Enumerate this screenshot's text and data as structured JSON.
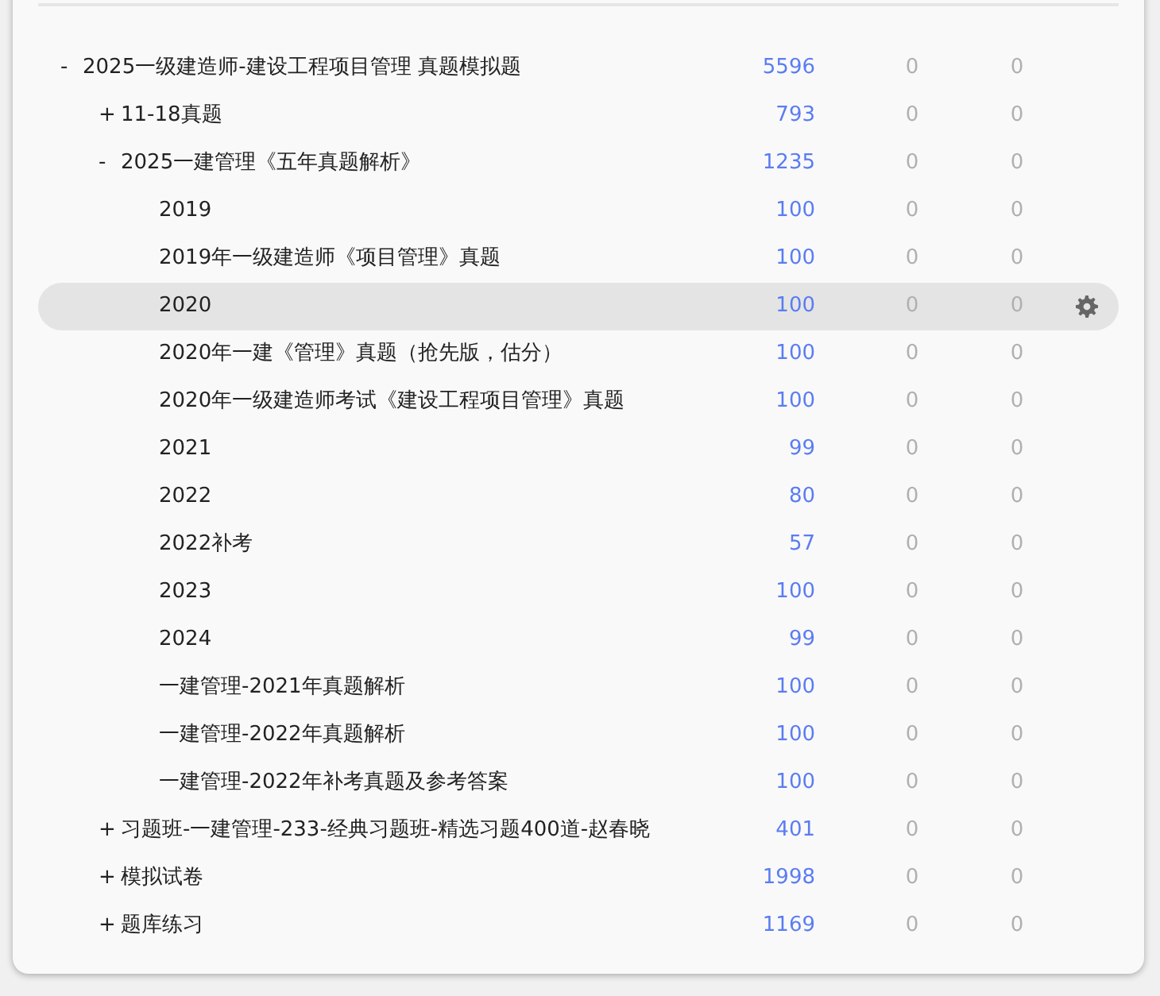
{
  "tree": [
    {
      "toggle": "-",
      "label": "2025一级建造师-建设工程项目管理 真题模拟题",
      "count": "5596",
      "column_3": "0",
      "column_4": "0",
      "selected": false,
      "children": [
        {
          "toggle": "+",
          "label": "11-18真题",
          "count": "793",
          "column_3": "0",
          "column_4": "0",
          "selected": false
        },
        {
          "toggle": "-",
          "label": "2025一建管理《五年真题解析》",
          "count": "1235",
          "column_3": "0",
          "column_4": "0",
          "selected": false,
          "children": [
            {
              "label": "2019",
              "count": "100",
              "column_3": "0",
              "column_4": "0",
              "selected": false
            },
            {
              "label": "2019年一级建造师《项目管理》真题",
              "count": "100",
              "column_3": "0",
              "column_4": "0",
              "selected": false
            },
            {
              "label": "2020",
              "count": "100",
              "column_3": "0",
              "column_4": "0",
              "selected": true
            },
            {
              "label": "2020年一建《管理》真题（抢先版，估分）",
              "count": "100",
              "column_3": "0",
              "column_4": "0",
              "selected": false
            },
            {
              "label": "2020年一级建造师考试《建设工程项目管理》真题",
              "count": "100",
              "column_3": "0",
              "column_4": "0",
              "selected": false
            },
            {
              "label": "2021",
              "count": "99",
              "column_3": "0",
              "column_4": "0",
              "selected": false
            },
            {
              "label": "2022",
              "count": "80",
              "column_3": "0",
              "column_4": "0",
              "selected": false
            },
            {
              "label": "2022补考",
              "count": "57",
              "column_3": "0",
              "column_4": "0",
              "selected": false
            },
            {
              "label": "2023",
              "count": "100",
              "column_3": "0",
              "column_4": "0",
              "selected": false
            },
            {
              "label": "2024",
              "count": "99",
              "column_3": "0",
              "column_4": "0",
              "selected": false
            },
            {
              "label": "一建管理-2021年真题解析",
              "count": "100",
              "column_3": "0",
              "column_4": "0",
              "selected": false
            },
            {
              "label": "一建管理-2022年真题解析",
              "count": "100",
              "column_3": "0",
              "column_4": "0",
              "selected": false
            },
            {
              "label": "一建管理-2022年补考真题及参考答案",
              "count": "100",
              "column_3": "0",
              "column_4": "0",
              "selected": false
            }
          ]
        },
        {
          "toggle": "+",
          "label": "习题班-一建管理-233-经典习题班-精选习题400道-赵春晓",
          "count": "401",
          "column_3": "0",
          "column_4": "0",
          "selected": false
        },
        {
          "toggle": "+",
          "label": "模拟试卷",
          "count": "1998",
          "column_3": "0",
          "column_4": "0",
          "selected": false
        },
        {
          "toggle": "+",
          "label": "题库练习",
          "count": "1169",
          "column_3": "0",
          "column_4": "0",
          "selected": false
        }
      ]
    }
  ]
}
